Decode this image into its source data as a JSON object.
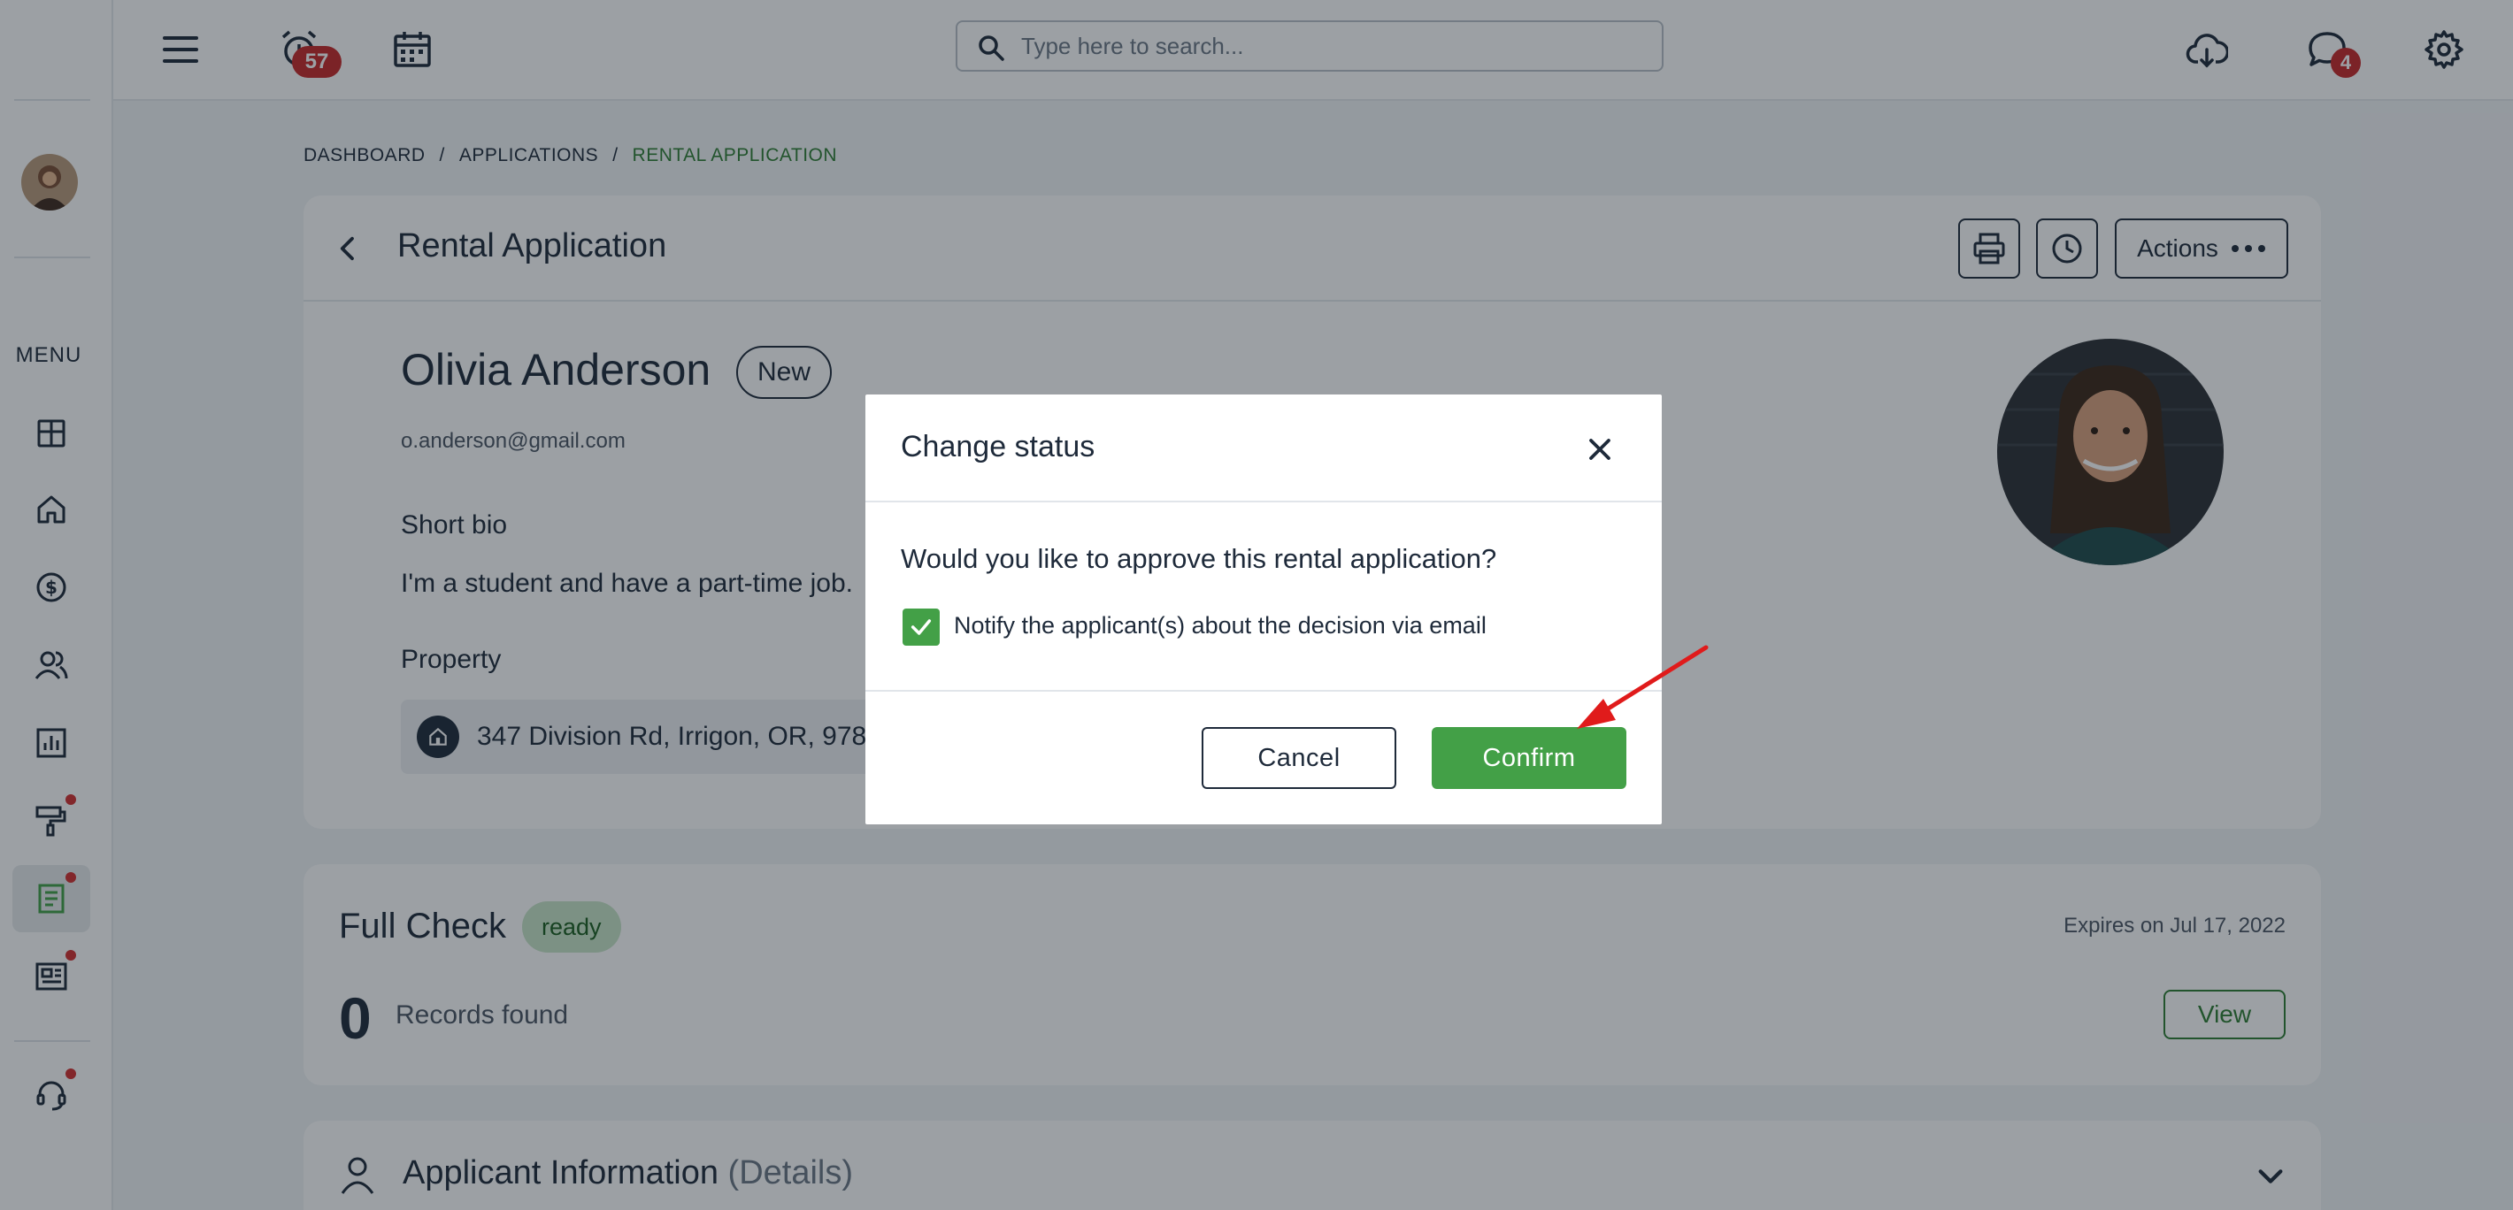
{
  "topbar": {
    "alarm_badge": "57",
    "search_placeholder": "Type here to search...",
    "messages_badge": "4"
  },
  "sidebar": {
    "menu_label": "MENU",
    "items": [
      {
        "name": "dashboard",
        "icon": "dashboard-grid-icon"
      },
      {
        "name": "properties",
        "icon": "home-icon"
      },
      {
        "name": "accounting",
        "icon": "dollar-circle-icon"
      },
      {
        "name": "people",
        "icon": "people-icon"
      },
      {
        "name": "reports",
        "icon": "bar-chart-icon"
      },
      {
        "name": "maintenance",
        "icon": "paint-roller-icon"
      },
      {
        "name": "applications",
        "icon": "document-icon"
      },
      {
        "name": "listings",
        "icon": "newspaper-icon"
      },
      {
        "name": "support",
        "icon": "headset-icon"
      }
    ]
  },
  "breadcrumb": {
    "items": [
      "DASHBOARD",
      "APPLICATIONS",
      "RENTAL APPLICATION"
    ],
    "separator": "/"
  },
  "application": {
    "page_title": "Rental Application",
    "actions_label": "Actions",
    "applicant_name": "Olivia Anderson",
    "status": "New",
    "email": "o.anderson@gmail.com",
    "bio_label": "Short bio",
    "bio_text": "I'm a student and have a part-time job.",
    "property_label": "Property",
    "property_address": "347 Division Rd, Irrigon, OR, 978"
  },
  "full_check": {
    "title": "Full Check",
    "status": "ready",
    "expires": "Expires on Jul 17, 2022",
    "records_count": "0",
    "records_label": "Records found",
    "view_label": "View"
  },
  "applicant_info": {
    "title": "Applicant Information",
    "subtitle": "(Details)"
  },
  "modal": {
    "title": "Change status",
    "question": "Would you like to approve this rental application?",
    "notify_label": "Notify the applicant(s) about the decision via email",
    "notify_checked": true,
    "cancel_label": "Cancel",
    "confirm_label": "Confirm"
  },
  "colors": {
    "accent_green": "#43a047",
    "badge_red": "#c62828",
    "annotation_arrow": "#e01b1b"
  }
}
